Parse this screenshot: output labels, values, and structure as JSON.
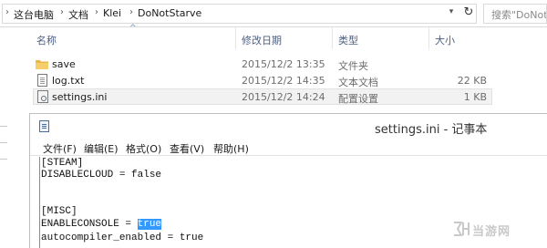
{
  "address_bar": {
    "breadcrumbs": [
      "这台电脑",
      "文档",
      "Klei",
      "DoNotStarve"
    ],
    "search_placeholder": "搜索\"DoNot"
  },
  "file_list": {
    "columns": {
      "name": "名称",
      "modified": "修改日期",
      "type": "类型",
      "size": "大小"
    },
    "rows": [
      {
        "name": "save",
        "modified": "2015/12/2 13:35",
        "type": "文件夹",
        "size": "",
        "icon": "folder-icon"
      },
      {
        "name": "log.txt",
        "modified": "2015/12/2 14:35",
        "type": "文本文档",
        "size": "22 KB",
        "icon": "text-file-icon"
      },
      {
        "name": "settings.ini",
        "modified": "2015/12/2 14:24",
        "type": "配置设置",
        "size": "1 KB",
        "icon": "ini-file-icon"
      }
    ]
  },
  "notepad": {
    "title": "settings.ini - 记事本",
    "menu": [
      "文件(F)",
      "编辑(E)",
      "格式(O)",
      "查看(V)",
      "帮助(H)"
    ],
    "lines": [
      "[STEAM]",
      "DISABLECLOUD = false",
      "",
      "[MISC]",
      "ENABLECONSOLE = ",
      "autocompiler_enabled = true"
    ],
    "selected_text": "true"
  },
  "watermark": {
    "text": "当游网"
  },
  "colors": {
    "header_text": "#4d6082",
    "selection_highlight": "#3399ff",
    "folder": "#e8b94a"
  }
}
